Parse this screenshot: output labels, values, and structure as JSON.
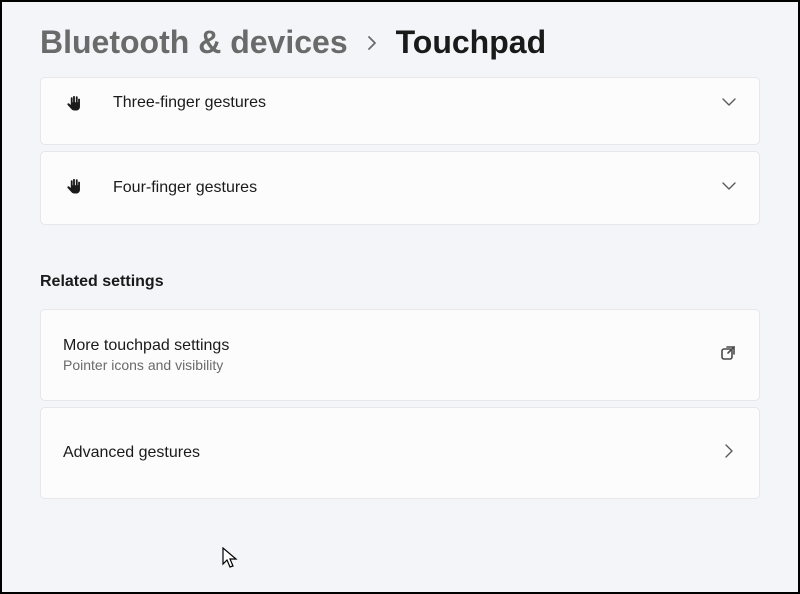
{
  "breadcrumb": {
    "parent": "Bluetooth & devices",
    "current": "Touchpad"
  },
  "gestureCards": [
    {
      "label": "Three-finger gestures"
    },
    {
      "label": "Four-finger gestures"
    }
  ],
  "relatedSection": {
    "header": "Related settings",
    "items": [
      {
        "title": "More touchpad settings",
        "subtitle": "Pointer icons and visibility",
        "type": "external"
      },
      {
        "title": "Advanced gestures",
        "subtitle": "",
        "type": "nav"
      }
    ]
  }
}
